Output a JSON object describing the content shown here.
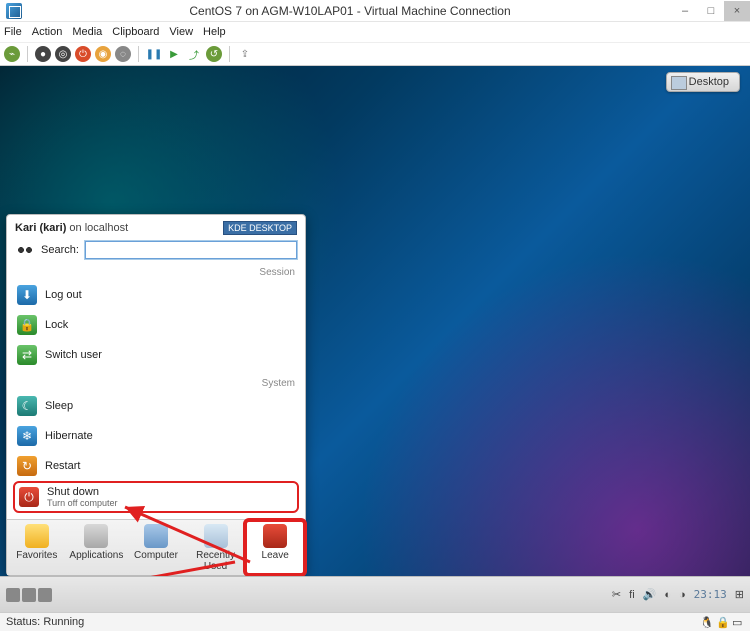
{
  "host": {
    "title": "CentOS 7 on AGM-W10LAP01 - Virtual Machine Connection",
    "menus": [
      "File",
      "Action",
      "Media",
      "Clipboard",
      "View",
      "Help"
    ],
    "status_label": "Status:",
    "status_value": "Running",
    "window_controls": {
      "min": "–",
      "max": "□",
      "close": "×"
    }
  },
  "guest": {
    "desktop_button": "Desktop",
    "taskbar": {
      "lang": "fi",
      "clock": "23:13"
    }
  },
  "launcher": {
    "user_name": "Kari (kari)",
    "on_word": " on ",
    "host_name": "localhost",
    "kde_badge": "KDE DESKTOP",
    "search_label": "Search:",
    "search_placeholder": "",
    "section_session": "Session",
    "section_system": "System",
    "session_items": [
      {
        "label": "Log out",
        "icon": "logout"
      },
      {
        "label": "Lock",
        "icon": "lock"
      },
      {
        "label": "Switch user",
        "icon": "switch"
      }
    ],
    "system_items": [
      {
        "label": "Sleep",
        "icon": "sleep"
      },
      {
        "label": "Hibernate",
        "icon": "hibernate"
      },
      {
        "label": "Restart",
        "icon": "restart"
      },
      {
        "label": "Shut down",
        "sub": "Turn off computer",
        "icon": "shutdown"
      }
    ],
    "tabs": [
      {
        "label": "Favorites",
        "icon": "star"
      },
      {
        "label": "Applications",
        "icon": "apps"
      },
      {
        "label": "Computer",
        "icon": "comp"
      },
      {
        "label": "Recently Used",
        "icon": "recent"
      },
      {
        "label": "Leave",
        "icon": "leave"
      }
    ],
    "active_tab": 4,
    "highlighted_tab": 4,
    "highlighted_item": "Shut down"
  }
}
